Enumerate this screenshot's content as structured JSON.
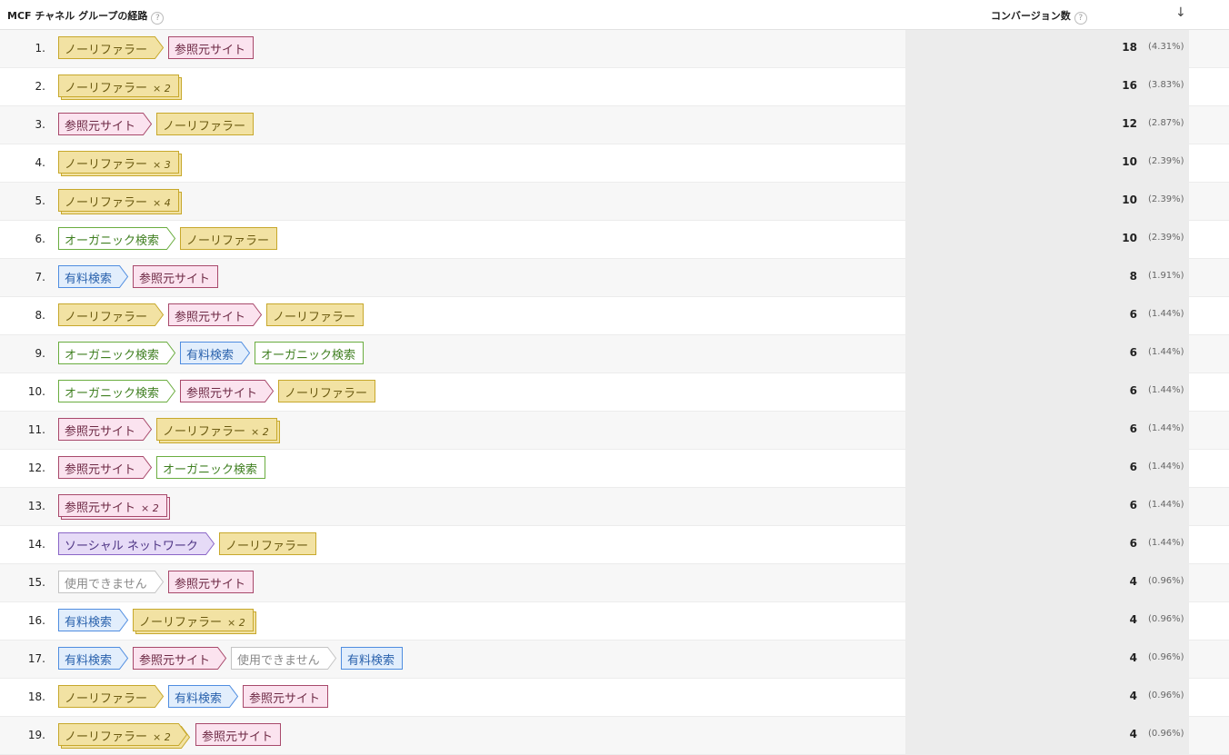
{
  "header": {
    "path_label": "MCF チャネル グループの経路",
    "help_symbol": "?",
    "conversions_label": "コンバージョン数",
    "sort_icon": "arrow-down-icon",
    "sort_symbol": "↓"
  },
  "channels": {
    "direct": {
      "label": "ノーリファラー",
      "bg": "#f2e2a3",
      "border": "#c7a82c",
      "text": "#6b5a10"
    },
    "referral": {
      "label": "参照元サイト",
      "bg": "#fbe3ef",
      "border": "#a8496b",
      "text": "#6e2a45"
    },
    "organic": {
      "label": "オーガニック検索",
      "bg": "#ffffff",
      "border": "#6aad3f",
      "text": "#3f7f20"
    },
    "paid": {
      "label": "有料検索",
      "bg": "#e2eefc",
      "border": "#4f8de0",
      "text": "#2a62ad"
    },
    "social": {
      "label": "ソーシャル ネットワーク",
      "bg": "#e6dbf7",
      "border": "#8a66c7",
      "text": "#4f3585"
    },
    "unavail": {
      "label": "使用できません",
      "bg": "#ffffff",
      "border": "#c4c4c4",
      "text": "#8a8a8a"
    }
  },
  "rows": [
    {
      "num": "1.",
      "path": [
        {
          "ch": "direct"
        },
        {
          "ch": "referral"
        }
      ],
      "conv": "18",
      "pct": "(4.31%)"
    },
    {
      "num": "2.",
      "path": [
        {
          "ch": "direct",
          "mult": "× 2"
        }
      ],
      "conv": "16",
      "pct": "(3.83%)"
    },
    {
      "num": "3.",
      "path": [
        {
          "ch": "referral"
        },
        {
          "ch": "direct"
        }
      ],
      "conv": "12",
      "pct": "(2.87%)"
    },
    {
      "num": "4.",
      "path": [
        {
          "ch": "direct",
          "mult": "× 3"
        }
      ],
      "conv": "10",
      "pct": "(2.39%)"
    },
    {
      "num": "5.",
      "path": [
        {
          "ch": "direct",
          "mult": "× 4"
        }
      ],
      "conv": "10",
      "pct": "(2.39%)"
    },
    {
      "num": "6.",
      "path": [
        {
          "ch": "organic"
        },
        {
          "ch": "direct"
        }
      ],
      "conv": "10",
      "pct": "(2.39%)"
    },
    {
      "num": "7.",
      "path": [
        {
          "ch": "paid"
        },
        {
          "ch": "referral"
        }
      ],
      "conv": "8",
      "pct": "(1.91%)"
    },
    {
      "num": "8.",
      "path": [
        {
          "ch": "direct"
        },
        {
          "ch": "referral"
        },
        {
          "ch": "direct"
        }
      ],
      "conv": "6",
      "pct": "(1.44%)"
    },
    {
      "num": "9.",
      "path": [
        {
          "ch": "organic"
        },
        {
          "ch": "paid"
        },
        {
          "ch": "organic"
        }
      ],
      "conv": "6",
      "pct": "(1.44%)"
    },
    {
      "num": "10.",
      "path": [
        {
          "ch": "organic"
        },
        {
          "ch": "referral"
        },
        {
          "ch": "direct"
        }
      ],
      "conv": "6",
      "pct": "(1.44%)"
    },
    {
      "num": "11.",
      "path": [
        {
          "ch": "referral"
        },
        {
          "ch": "direct",
          "mult": "× 2"
        }
      ],
      "conv": "6",
      "pct": "(1.44%)"
    },
    {
      "num": "12.",
      "path": [
        {
          "ch": "referral"
        },
        {
          "ch": "organic"
        }
      ],
      "conv": "6",
      "pct": "(1.44%)"
    },
    {
      "num": "13.",
      "path": [
        {
          "ch": "referral",
          "mult": "× 2"
        }
      ],
      "conv": "6",
      "pct": "(1.44%)"
    },
    {
      "num": "14.",
      "path": [
        {
          "ch": "social"
        },
        {
          "ch": "direct"
        }
      ],
      "conv": "6",
      "pct": "(1.44%)"
    },
    {
      "num": "15.",
      "path": [
        {
          "ch": "unavail"
        },
        {
          "ch": "referral"
        }
      ],
      "conv": "4",
      "pct": "(0.96%)"
    },
    {
      "num": "16.",
      "path": [
        {
          "ch": "paid"
        },
        {
          "ch": "direct",
          "mult": "× 2"
        }
      ],
      "conv": "4",
      "pct": "(0.96%)"
    },
    {
      "num": "17.",
      "path": [
        {
          "ch": "paid"
        },
        {
          "ch": "referral"
        },
        {
          "ch": "unavail"
        },
        {
          "ch": "paid"
        }
      ],
      "conv": "4",
      "pct": "(0.96%)"
    },
    {
      "num": "18.",
      "path": [
        {
          "ch": "direct"
        },
        {
          "ch": "paid"
        },
        {
          "ch": "referral"
        }
      ],
      "conv": "4",
      "pct": "(0.96%)"
    },
    {
      "num": "19.",
      "path": [
        {
          "ch": "direct",
          "mult": "× 2"
        },
        {
          "ch": "referral"
        }
      ],
      "conv": "4",
      "pct": "(0.96%)"
    }
  ]
}
